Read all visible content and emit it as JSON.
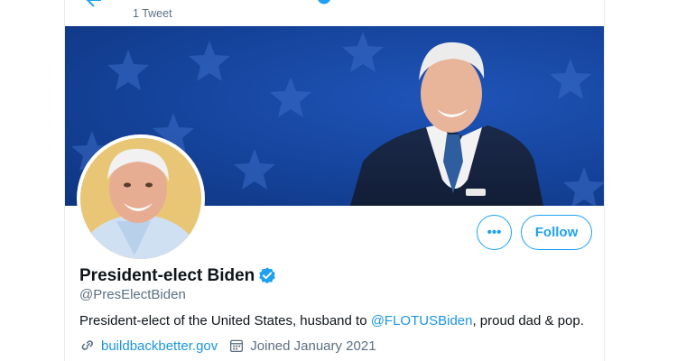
{
  "header": {
    "tweet_count": "1 Tweet"
  },
  "profile": {
    "display_name": "President-elect Biden",
    "handle": "@PresElectBiden",
    "bio_prefix": "President-elect of the United States, husband to ",
    "bio_mention": "@FLOTUSBiden",
    "bio_suffix": ", proud dad & pop.",
    "website": "buildbackbetter.gov",
    "joined": "Joined January 2021",
    "verified": true
  },
  "actions": {
    "more_label": "•••",
    "follow_label": "Follow"
  },
  "colors": {
    "accent": "#1da1f2",
    "link": "#1b95e0",
    "secondary_text": "#5b7083",
    "banner_blue": "#1646a0"
  },
  "icons": {
    "back": "back-arrow-icon",
    "verified": "verified-badge-icon",
    "link": "link-icon",
    "calendar": "calendar-icon"
  }
}
